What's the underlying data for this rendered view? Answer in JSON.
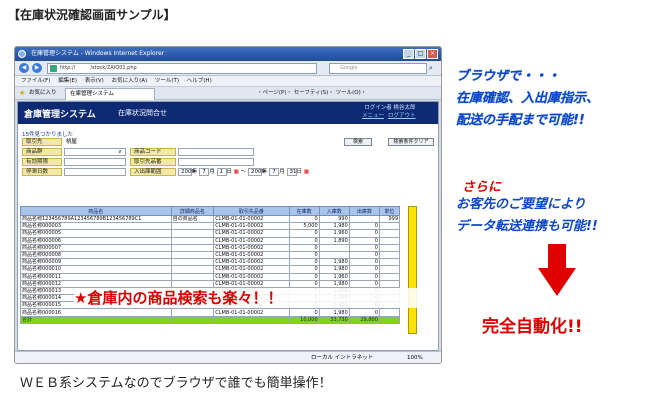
{
  "page_title": "【在庫状況確認画面サンプル】",
  "browser": {
    "window_title": "在庫管理システム - Windows Internet Explorer",
    "address": "http://　　　/stock/ZAIQ01.php",
    "search_placeholder": "Google",
    "menus": [
      "ファイル(F)",
      "編集(E)",
      "表示(V)",
      "お気に入り(A)",
      "ツール(T)",
      "ヘルプ(H)"
    ],
    "favorites_label": "お気に入り",
    "tab_label": "在庫管理システム",
    "toolbar_text": "・ページ(P)・ セーフティ(S)・ ツール(O)・",
    "status_zone": "ローカル イントラネット",
    "status_zoom": "100%"
  },
  "app": {
    "name": "倉庫管理システム",
    "screen_title": "在庫状況問合せ",
    "login_label": "ログイン者",
    "login_user": "桃谷太郎",
    "menu_link": "メニュー",
    "logout_link": "ログアウト",
    "found_text": "15件見つかりました",
    "form": {
      "torihikisaki": "取引先",
      "torihikisaki_value": "桃屋",
      "shohingun": "商品群",
      "shohin_code": "商品コード",
      "yuko_kigen": "有効期限",
      "torihikisakiban": "取引先品番",
      "saishu_nissu": "停滞日数",
      "nyushuko_hani": "入出庫範囲",
      "date_from_year": "2009",
      "date_from_month": "7",
      "date_from_day": "1",
      "date_to_year": "2009",
      "date_to_month": "7",
      "date_to_day": "31",
      "sep_year": "年",
      "sep_month": "月",
      "sep_day": "日",
      "tilde": "〜",
      "search_button": "検索",
      "clear_button": "検索条件クリア"
    },
    "table": {
      "headers": [
        "商品名",
        "詳細商品名",
        "取引先品番",
        "在庫数",
        "入庫数",
        "出庫数",
        "単位"
      ],
      "rows": [
        [
          "商品名称123456789A123456789B123456789C1",
          "自の商品名",
          "CLMB-01-01-00002",
          "0",
          "990",
          "",
          "999"
        ],
        [
          "商品名称000003",
          "",
          "CLMB-01-01-00002",
          "5,000",
          "1,980",
          "0",
          ""
        ],
        [
          "商品名称000005",
          "",
          "CLMB-01-01-00002",
          "0",
          "1,960",
          "0",
          ""
        ],
        [
          "商品名称000006",
          "",
          "CLMB-01-01-00002",
          "0",
          "1,890",
          "0",
          ""
        ],
        [
          "商品名称000007",
          "",
          "CLMB-01-01-00002",
          "0",
          "",
          "0",
          ""
        ],
        [
          "商品名称000008",
          "",
          "CLMB-01-01-00002",
          "0",
          "",
          "0",
          ""
        ],
        [
          "商品名称000009",
          "",
          "CLMB-01-01-00002",
          "0",
          "1,980",
          "0",
          ""
        ],
        [
          "商品名称000010",
          "",
          "CLMB-01-01-00002",
          "0",
          "1,980",
          "0",
          ""
        ],
        [
          "商品名称000011",
          "",
          "CLMB-01-01-00002",
          "0",
          "1,960",
          "0",
          ""
        ],
        [
          "商品名称000012",
          "",
          "CLMB-01-01-00002",
          "0",
          "1,980",
          "0",
          ""
        ],
        [
          "商品名称000013",
          "",
          "CLMB-01-01-00002",
          "0",
          "2,000",
          "0",
          ""
        ],
        [
          "商品名称000014",
          "",
          "CLMB-01-01-00002",
          "0",
          "2,000",
          "0",
          ""
        ],
        [
          "商品名称000015",
          "",
          "CLMB-01-01-00002",
          "0",
          "1,980",
          "0",
          ""
        ],
        [
          "商品名称000016",
          "",
          "CLMB-01-01-00002",
          "0",
          "1,980",
          "0",
          ""
        ]
      ],
      "total": [
        "合計",
        "",
        "",
        "10,000",
        "33,730",
        "29,800",
        ""
      ]
    }
  },
  "overlay_text": "★倉庫内の商品検索も楽々！！",
  "right_text_1": "ブラウザで・・・\n在庫確認、入出庫指示、\n配送の手配まで可能!!",
  "sarani": "さらに",
  "right_text_2": "お客先のご要望により\nデータ転送連携も可能!!",
  "auto_text": "完全自動化!!",
  "bottom_text": "ＷＥＢ系システムなのでブラウザで誰でも簡単操作！",
  "colors": {
    "accent_blue": "#0d47c8",
    "accent_red": "#e00000",
    "header_navy": "#0f2a74",
    "total_green": "#7fd21f"
  }
}
